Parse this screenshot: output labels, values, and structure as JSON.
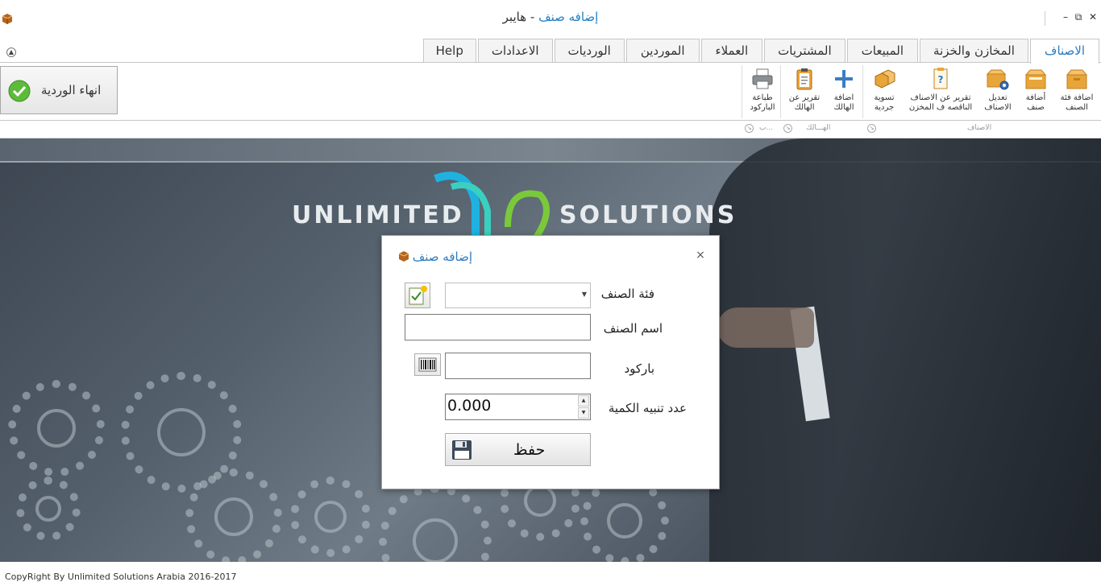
{
  "window": {
    "title_part1": "إضافه صنف",
    "title_part2": " - هايبر",
    "min_glyph": "–",
    "restore_glyph": "⧉",
    "close_glyph": "✕"
  },
  "tabs": [
    {
      "label": "الاصناف",
      "active": true
    },
    {
      "label": "المخازن والخزنة",
      "active": false
    },
    {
      "label": "المبيعات",
      "active": false
    },
    {
      "label": "المشتريات",
      "active": false
    },
    {
      "label": "العملاء",
      "active": false
    },
    {
      "label": "الموردين",
      "active": false
    },
    {
      "label": "الورديات",
      "active": false
    },
    {
      "label": "الاعدادات",
      "active": false
    },
    {
      "label": "Help",
      "active": false
    }
  ],
  "ribbon": {
    "buttons": [
      {
        "label": "اضافة فئة\nالصنف",
        "icon": "box-folder-icon"
      },
      {
        "label": "أضافة\nصنف",
        "icon": "box-add-icon"
      },
      {
        "label": "تعديل\nالاصناف",
        "icon": "box-settings-icon"
      },
      {
        "label": "تقرير عن الاصناف\nالناقصه ف المخزن",
        "icon": "report-question-icon"
      },
      {
        "label": "تسوية\nجردية",
        "icon": "boxes-stack-icon"
      },
      {
        "label": "اضافة\nالهالك",
        "icon": "plus-icon"
      },
      {
        "label": "تقرير عن\nالهالك",
        "icon": "clipboard-icon"
      },
      {
        "label": "طباعة\nالباركود",
        "icon": "printer-icon"
      }
    ],
    "groups": [
      {
        "label": "الاصناف"
      },
      {
        "label": "الهـــالك"
      },
      {
        "label": "ب..."
      }
    ],
    "end_shift_label": "انهاء الوردية"
  },
  "background": {
    "logo_left": "UNLIMITED",
    "logo_right": "SOLUTIONS"
  },
  "dialog": {
    "title": "إضافه صنف",
    "close_glyph": "×",
    "category_label": "فئة الصنف",
    "category_value": "",
    "name_label": "اسم الصنف",
    "name_value": "",
    "barcode_label": "باركود",
    "barcode_value": "",
    "alert_qty_label": "عدد تنبيه الكمية",
    "alert_qty_value": "0.000",
    "save_label": "حفظ"
  },
  "status": {
    "copyright": "CopyRight By Unlimited Solutions Arabia 2016-2017"
  },
  "colors": {
    "accent": "#2b7cc0",
    "ribbon_icon": "#e8a53a"
  }
}
